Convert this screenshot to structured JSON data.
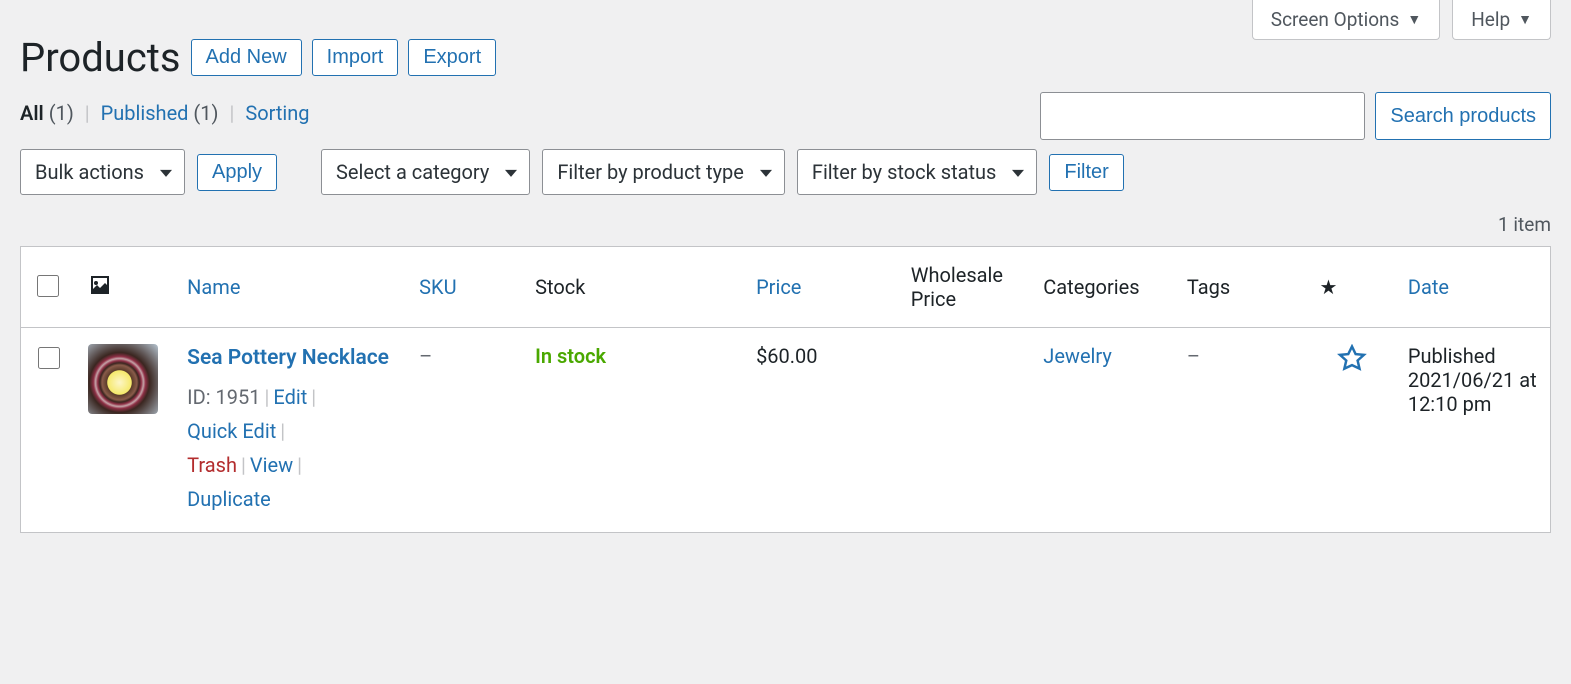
{
  "screen_tabs": {
    "screen_options": "Screen Options",
    "help": "Help"
  },
  "header": {
    "title": "Products",
    "add_new": "Add New",
    "import": "Import",
    "export": "Export"
  },
  "status_filters": {
    "all_label": "All",
    "all_count": "(1)",
    "published_label": "Published",
    "published_count": "(1)",
    "sorting_label": "Sorting"
  },
  "search": {
    "button": "Search products"
  },
  "filters": {
    "bulk_actions": "Bulk actions",
    "apply": "Apply",
    "category": "Select a category",
    "product_type": "Filter by product type",
    "stock_status": "Filter by stock status",
    "filter_btn": "Filter"
  },
  "count_text": "1 item",
  "columns": {
    "name": "Name",
    "sku": "SKU",
    "stock": "Stock",
    "price": "Price",
    "wholesale": "Wholesale Price",
    "categories": "Categories",
    "tags": "Tags",
    "date": "Date"
  },
  "rows": [
    {
      "title": "Sea Pottery Necklace",
      "id_label": "ID: 1951",
      "edit": "Edit",
      "quick_edit": "Quick Edit",
      "trash": "Trash",
      "view": "View",
      "duplicate": "Duplicate",
      "sku": "–",
      "stock": "In stock",
      "price": "$60.00",
      "wholesale": "",
      "category": "Jewelry",
      "tags": "–",
      "date_status": "Published",
      "date_value": "2021/06/21 at 12:10 pm"
    }
  ]
}
